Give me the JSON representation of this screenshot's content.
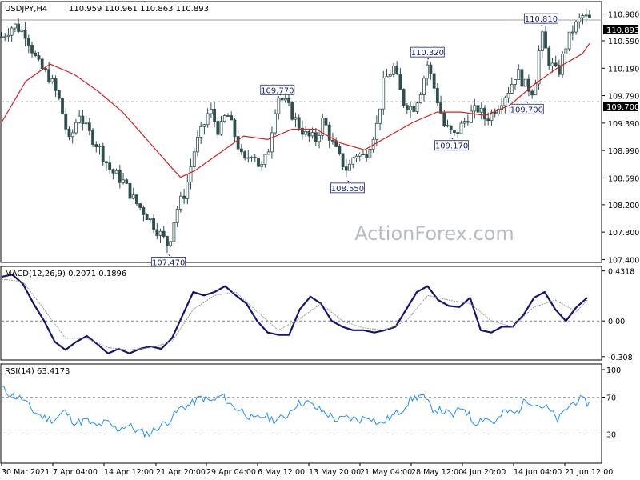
{
  "header": {
    "symbol": "USDJPY,H4",
    "ohlc": "110.959 110.961 110.863 110.893"
  },
  "watermark": "ActionForex.com",
  "colors": {
    "candle": "#2f4f4f",
    "ma": "#d62020",
    "macd": "#141472",
    "signal": "#9a9a9a",
    "rsi": "#1e90ff",
    "level_line": "#808080",
    "label_text": "#1a237e",
    "price_tag_bg": "#000000",
    "price_tag_text": "#ffffff"
  },
  "price_tags": {
    "current": "110.893",
    "level": "109.700"
  },
  "chart_data": [
    {
      "type": "candlestick",
      "panel": "price",
      "title": "USDJPY,H4",
      "y_ticks": [
        "110.980",
        "110.590",
        "110.190",
        "109.790",
        "109.390",
        "108.990",
        "108.590",
        "108.200",
        "107.800",
        "107.400"
      ],
      "y_tick_values": [
        110.98,
        110.59,
        110.19,
        109.79,
        109.39,
        108.99,
        108.59,
        108.2,
        107.8,
        107.4
      ],
      "ylim": [
        107.37,
        111.15
      ],
      "x_labels": [
        "30 Mar 2021",
        "7 Apr 04:00",
        "14 Apr 12:00",
        "21 Apr 20:00",
        "29 Apr 04:00",
        "6 May 12:00",
        "13 May 20:00",
        "21 May 04:00",
        "28 May 12:00",
        "4 Jun 20:00",
        "14 Jun 04:00",
        "21 Jun 12:00"
      ],
      "close_path": [
        [
          0,
          110.65
        ],
        [
          0.5,
          110.82
        ],
        [
          1,
          110.7
        ],
        [
          1.5,
          110.25
        ],
        [
          2,
          110.05
        ],
        [
          2.4,
          109.7
        ],
        [
          2.8,
          109.1
        ],
        [
          3.2,
          109.55
        ],
        [
          3.5,
          109.3
        ],
        [
          4,
          109.05
        ],
        [
          4.5,
          108.7
        ],
        [
          5,
          108.55
        ],
        [
          5.5,
          108.25
        ],
        [
          6,
          108.05
        ],
        [
          6.5,
          107.8
        ],
        [
          6.9,
          107.6
        ],
        [
          7.2,
          108.1
        ],
        [
          7.6,
          108.4
        ],
        [
          8,
          109.05
        ],
        [
          8.3,
          109.3
        ],
        [
          8.6,
          109.6
        ],
        [
          9,
          109.25
        ],
        [
          9.3,
          109.55
        ],
        [
          9.7,
          109.15
        ],
        [
          10,
          108.8
        ],
        [
          10.4,
          109.0
        ],
        [
          10.7,
          108.7
        ],
        [
          11,
          108.95
        ],
        [
          11.4,
          109.8
        ],
        [
          11.8,
          109.65
        ],
        [
          12.2,
          109.4
        ],
        [
          12.6,
          109.2
        ],
        [
          13,
          109.15
        ],
        [
          13.3,
          109.45
        ],
        [
          13.6,
          109.15
        ],
        [
          14,
          108.85
        ],
        [
          14.3,
          108.7
        ],
        [
          14.6,
          108.95
        ],
        [
          15,
          108.9
        ],
        [
          15.5,
          109.35
        ],
        [
          15.8,
          110.0
        ],
        [
          16.2,
          110.2
        ],
        [
          16.6,
          109.7
        ],
        [
          17,
          109.6
        ],
        [
          17.3,
          109.85
        ],
        [
          17.6,
          110.25
        ],
        [
          18,
          109.75
        ],
        [
          18.3,
          109.35
        ],
        [
          18.7,
          109.2
        ],
        [
          19,
          109.35
        ],
        [
          19.3,
          109.5
        ],
        [
          19.7,
          109.6
        ],
        [
          20,
          109.45
        ],
        [
          20.3,
          109.55
        ],
        [
          20.7,
          109.75
        ],
        [
          21,
          109.9
        ],
        [
          21.3,
          110.15
        ],
        [
          21.6,
          109.95
        ],
        [
          22,
          109.85
        ],
        [
          22.3,
          110.7
        ],
        [
          22.6,
          110.3
        ],
        [
          23,
          110.1
        ],
        [
          23.3,
          110.5
        ],
        [
          23.6,
          110.75
        ],
        [
          24,
          110.95
        ],
        [
          24.3,
          110.893
        ]
      ],
      "ma_path": [
        [
          0,
          109.4
        ],
        [
          1,
          110.0
        ],
        [
          2,
          110.25
        ],
        [
          3,
          110.1
        ],
        [
          4,
          109.85
        ],
        [
          5,
          109.55
        ],
        [
          6,
          109.15
        ],
        [
          7,
          108.75
        ],
        [
          7.4,
          108.6
        ],
        [
          8,
          108.7
        ],
        [
          9,
          108.95
        ],
        [
          10,
          109.2
        ],
        [
          11,
          109.15
        ],
        [
          12,
          109.3
        ],
        [
          13,
          109.3
        ],
        [
          14,
          109.1
        ],
        [
          15,
          109.0
        ],
        [
          16,
          109.2
        ],
        [
          17,
          109.4
        ],
        [
          18,
          109.55
        ],
        [
          19,
          109.55
        ],
        [
          20,
          109.5
        ],
        [
          21,
          109.65
        ],
        [
          22,
          109.95
        ],
        [
          23,
          110.2
        ],
        [
          24,
          110.4
        ],
        [
          24.3,
          110.55
        ]
      ],
      "annotations": [
        {
          "text": "107.470",
          "x": 6.9,
          "value": 107.47
        },
        {
          "text": "109.770",
          "x": 11.4,
          "value": 109.77
        },
        {
          "text": "108.550",
          "x": 14.3,
          "value": 108.55
        },
        {
          "text": "110.320",
          "x": 17.6,
          "value": 110.32
        },
        {
          "text": "109.170",
          "x": 18.6,
          "value": 109.17
        },
        {
          "text": "110.810",
          "x": 22.3,
          "value": 110.81
        },
        {
          "text": "109.700",
          "x": 21.7,
          "value": 109.7
        }
      ],
      "horizontal_level": 109.7,
      "current_price": 110.893
    },
    {
      "type": "line",
      "panel": "macd",
      "title": "MACD(12,26,9) 0.2071 0.1896",
      "y_ticks": [
        "0.4318",
        "0.00",
        "-0.308"
      ],
      "ylim": [
        -0.33,
        0.45
      ],
      "series": [
        {
          "role": "macd",
          "points": [
            [
              0,
              0.38
            ],
            [
              0.5,
              0.4
            ],
            [
              1,
              0.32
            ],
            [
              1.5,
              0.15
            ],
            [
              2,
              0.0
            ],
            [
              2.5,
              -0.18
            ],
            [
              3,
              -0.25
            ],
            [
              3.5,
              -0.18
            ],
            [
              4,
              -0.13
            ],
            [
              4.5,
              -0.2
            ],
            [
              5,
              -0.28
            ],
            [
              5.5,
              -0.24
            ],
            [
              6,
              -0.28
            ],
            [
              6.5,
              -0.24
            ],
            [
              7,
              -0.22
            ],
            [
              7.5,
              -0.24
            ],
            [
              8,
              -0.15
            ],
            [
              8.5,
              0.05
            ],
            [
              9,
              0.25
            ],
            [
              9.5,
              0.22
            ],
            [
              10,
              0.25
            ],
            [
              10.5,
              0.3
            ],
            [
              11,
              0.22
            ],
            [
              11.5,
              0.15
            ],
            [
              12,
              0.0
            ],
            [
              12.5,
              -0.1
            ],
            [
              13,
              -0.12
            ],
            [
              13.5,
              -0.12
            ],
            [
              14,
              0.1
            ],
            [
              14.5,
              0.21
            ],
            [
              15,
              0.15
            ],
            [
              15.5,
              0.0
            ],
            [
              16,
              -0.05
            ],
            [
              16.5,
              -0.08
            ],
            [
              17,
              -0.08
            ],
            [
              17.5,
              -0.1
            ],
            [
              18,
              -0.08
            ],
            [
              18.5,
              -0.05
            ],
            [
              19,
              0.1
            ],
            [
              19.5,
              0.25
            ],
            [
              20,
              0.3
            ],
            [
              20.5,
              0.18
            ],
            [
              21,
              0.13
            ],
            [
              21.5,
              0.12
            ],
            [
              22,
              0.2
            ],
            [
              22.5,
              -0.08
            ],
            [
              23,
              -0.1
            ],
            [
              23.5,
              -0.05
            ],
            [
              24,
              -0.05
            ],
            [
              24.5,
              0.05
            ],
            [
              25,
              0.2
            ],
            [
              25.5,
              0.25
            ],
            [
              26,
              0.1
            ],
            [
              26.5,
              0.0
            ],
            [
              27,
              0.12
            ],
            [
              27.5,
              0.2
            ]
          ]
        },
        {
          "role": "signal",
          "points": [
            [
              0,
              0.36
            ],
            [
              1,
              0.34
            ],
            [
              2,
              0.1
            ],
            [
              3,
              -0.15
            ],
            [
              4,
              -0.15
            ],
            [
              5,
              -0.23
            ],
            [
              6,
              -0.25
            ],
            [
              7,
              -0.23
            ],
            [
              8,
              -0.18
            ],
            [
              9,
              0.1
            ],
            [
              10,
              0.22
            ],
            [
              11,
              0.25
            ],
            [
              12,
              0.08
            ],
            [
              13,
              -0.08
            ],
            [
              14,
              0.02
            ],
            [
              15,
              0.15
            ],
            [
              16,
              0.0
            ],
            [
              17,
              -0.06
            ],
            [
              18,
              -0.08
            ],
            [
              19,
              0.0
            ],
            [
              20,
              0.22
            ],
            [
              21,
              0.18
            ],
            [
              22,
              0.15
            ],
            [
              23,
              0.0
            ],
            [
              24,
              -0.05
            ],
            [
              25,
              0.12
            ],
            [
              26,
              0.18
            ],
            [
              27,
              0.08
            ],
            [
              27.5,
              0.18
            ]
          ]
        }
      ]
    },
    {
      "type": "line",
      "panel": "rsi",
      "title": "RSI(14) 63.4173",
      "y_ticks": [
        "100",
        "70",
        "30"
      ],
      "ylim": [
        0,
        100
      ],
      "levels": [
        70,
        30
      ],
      "series": [
        {
          "role": "rsi",
          "points": [
            [
              0,
              80
            ],
            [
              0.5,
              72
            ],
            [
              1,
              68
            ],
            [
              1.5,
              55
            ],
            [
              2,
              48
            ],
            [
              2.5,
              45
            ],
            [
              3,
              55
            ],
            [
              3.5,
              42
            ],
            [
              4,
              45
            ],
            [
              4.5,
              38
            ],
            [
              5,
              43
            ],
            [
              5.5,
              35
            ],
            [
              6,
              40
            ],
            [
              6.5,
              33
            ],
            [
              7,
              30
            ],
            [
              7.5,
              38
            ],
            [
              8,
              45
            ],
            [
              8.5,
              58
            ],
            [
              9,
              62
            ],
            [
              9.5,
              70
            ],
            [
              10,
              65
            ],
            [
              10.5,
              72
            ],
            [
              11,
              60
            ],
            [
              11.5,
              55
            ],
            [
              12,
              45
            ],
            [
              12.5,
              50
            ],
            [
              13,
              45
            ],
            [
              13.5,
              48
            ],
            [
              14,
              62
            ],
            [
              14.5,
              65
            ],
            [
              15,
              58
            ],
            [
              15.5,
              52
            ],
            [
              16,
              45
            ],
            [
              16.5,
              48
            ],
            [
              17,
              45
            ],
            [
              17.5,
              50
            ],
            [
              18,
              40
            ],
            [
              18.5,
              48
            ],
            [
              19,
              55
            ],
            [
              19.5,
              68
            ],
            [
              20,
              72
            ],
            [
              20.5,
              58
            ],
            [
              21,
              55
            ],
            [
              21.5,
              50
            ],
            [
              22,
              60
            ],
            [
              22.5,
              42
            ],
            [
              23,
              48
            ],
            [
              23.5,
              42
            ],
            [
              24,
              55
            ],
            [
              24.5,
              52
            ],
            [
              25,
              68
            ],
            [
              25.5,
              62
            ],
            [
              26,
              58
            ],
            [
              26.5,
              45
            ],
            [
              27,
              60
            ],
            [
              27.5,
              68
            ],
            [
              28,
              63
            ]
          ]
        }
      ]
    }
  ]
}
